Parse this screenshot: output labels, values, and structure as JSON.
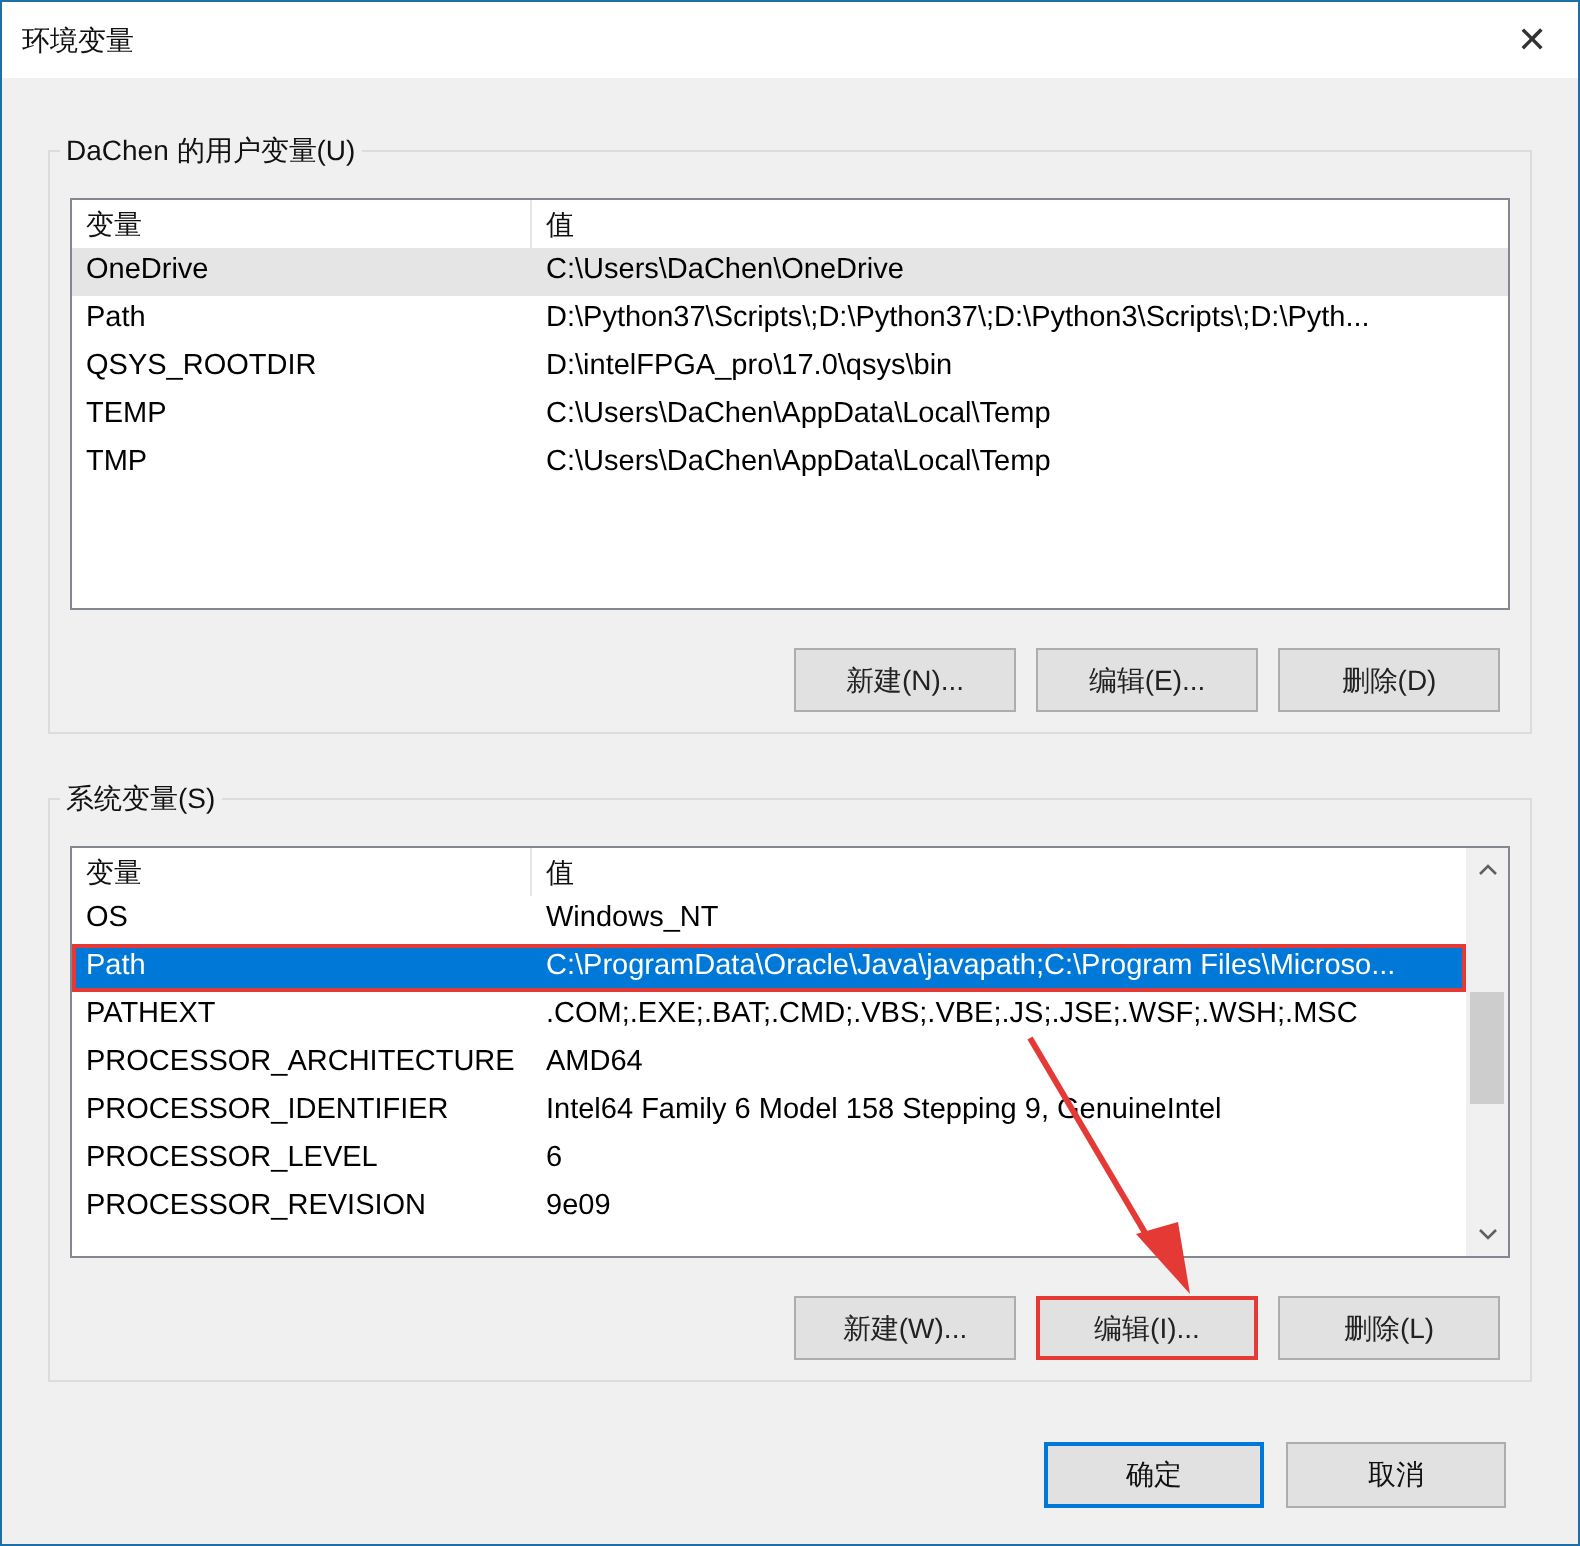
{
  "window": {
    "title": "环境变量",
    "close": "✕"
  },
  "user_vars": {
    "label": "DaChen 的用户变量(U)",
    "columns": [
      "变量",
      "值"
    ],
    "rows": [
      {
        "name": "OneDrive",
        "value": "C:\\Users\\DaChen\\OneDrive",
        "selected": false,
        "hovered": true,
        "highlighted": false
      },
      {
        "name": "Path",
        "value": "D:\\Python37\\Scripts\\;D:\\Python37\\;D:\\Python3\\Scripts\\;D:\\Pyth...",
        "selected": false,
        "hovered": false,
        "highlighted": false
      },
      {
        "name": "QSYS_ROOTDIR",
        "value": "D:\\intelFPGA_pro\\17.0\\qsys\\bin",
        "selected": false,
        "hovered": false,
        "highlighted": false
      },
      {
        "name": "TEMP",
        "value": "C:\\Users\\DaChen\\AppData\\Local\\Temp",
        "selected": false,
        "hovered": false,
        "highlighted": false
      },
      {
        "name": "TMP",
        "value": "C:\\Users\\DaChen\\AppData\\Local\\Temp",
        "selected": false,
        "hovered": false,
        "highlighted": false
      }
    ],
    "scrollbar": false,
    "buttons": [
      {
        "label": "新建(N)...",
        "highlighted": false
      },
      {
        "label": "编辑(E)...",
        "highlighted": false
      },
      {
        "label": "删除(D)",
        "highlighted": false
      }
    ]
  },
  "system_vars": {
    "label": "系统变量(S)",
    "columns": [
      "变量",
      "值"
    ],
    "rows": [
      {
        "name": "OS",
        "value": "Windows_NT",
        "selected": false,
        "hovered": false,
        "highlighted": false
      },
      {
        "name": "Path",
        "value": "C:\\ProgramData\\Oracle\\Java\\javapath;C:\\Program Files\\Microso...",
        "selected": true,
        "hovered": false,
        "highlighted": true
      },
      {
        "name": "PATHEXT",
        "value": ".COM;.EXE;.BAT;.CMD;.VBS;.VBE;.JS;.JSE;.WSF;.WSH;.MSC",
        "selected": false,
        "hovered": false,
        "highlighted": false
      },
      {
        "name": "PROCESSOR_ARCHITECTURE",
        "value": "AMD64",
        "selected": false,
        "hovered": false,
        "highlighted": false
      },
      {
        "name": "PROCESSOR_IDENTIFIER",
        "value": "Intel64 Family 6 Model 158 Stepping 9, GenuineIntel",
        "selected": false,
        "hovered": false,
        "highlighted": false
      },
      {
        "name": "PROCESSOR_LEVEL",
        "value": "6",
        "selected": false,
        "hovered": false,
        "highlighted": false
      },
      {
        "name": "PROCESSOR_REVISION",
        "value": "9e09",
        "selected": false,
        "hovered": false,
        "highlighted": false
      }
    ],
    "scrollbar": true,
    "buttons": [
      {
        "label": "新建(W)...",
        "highlighted": false
      },
      {
        "label": "编辑(I)...",
        "highlighted": true
      },
      {
        "label": "删除(L)",
        "highlighted": false
      }
    ]
  },
  "footer_buttons": [
    {
      "label": "确定",
      "default": true
    },
    {
      "label": "取消",
      "default": false
    }
  ],
  "annotation_arrow": true
}
